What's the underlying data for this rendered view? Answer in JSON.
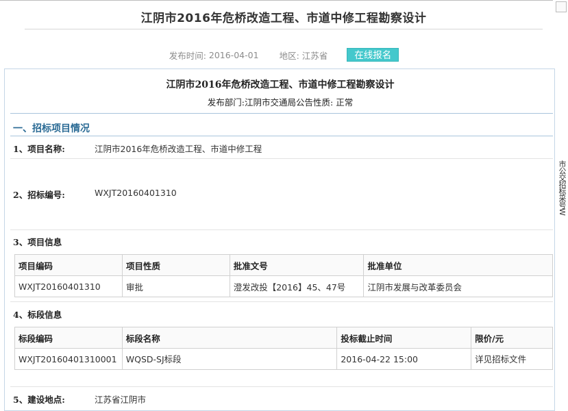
{
  "header": {
    "title": "江阴市2016年危桥改造工程、市道中修工程勘察设计",
    "publish_label": "发布时间:",
    "publish_date": "2016-04-01",
    "region_label": "地区:",
    "region": "江苏省",
    "signup_button": "在线报名"
  },
  "document": {
    "title": "江阴市2016年危桥改造工程、市道中修工程勘察设计",
    "subtitle": "发布部门:江阴市交通局公告性质: 正常",
    "section1": "一、招标项目情况",
    "item1_label": "1、项目名称:",
    "item1_value": "江阴市2016年危桥改造工程、市道中修工程",
    "item2_label": "2、招标编号:",
    "item2_value": "WXJT20160401310",
    "item3_label": "3、项目信息",
    "project_table": {
      "headers": [
        "项目编码",
        "项目性质",
        "批准文号",
        "批准单位"
      ],
      "row": [
        "WXJT20160401310",
        "审批",
        "澄发改投【2016】45、47号",
        "江阴市发展与改革委员会"
      ]
    },
    "item4_label": "4、标段信息",
    "section_table": {
      "headers": [
        "标段编码",
        "标段名称",
        "投标截止时间",
        "限价/元"
      ],
      "row": [
        "WXJT20160401310001",
        "WQSD-SJ标段",
        "2016-04-22 15:00",
        "详见招标文件"
      ]
    },
    "item5_label": "5、建设地点:",
    "item5_value": "江苏省江阴市"
  },
  "side_text": "市公交招标采号W"
}
